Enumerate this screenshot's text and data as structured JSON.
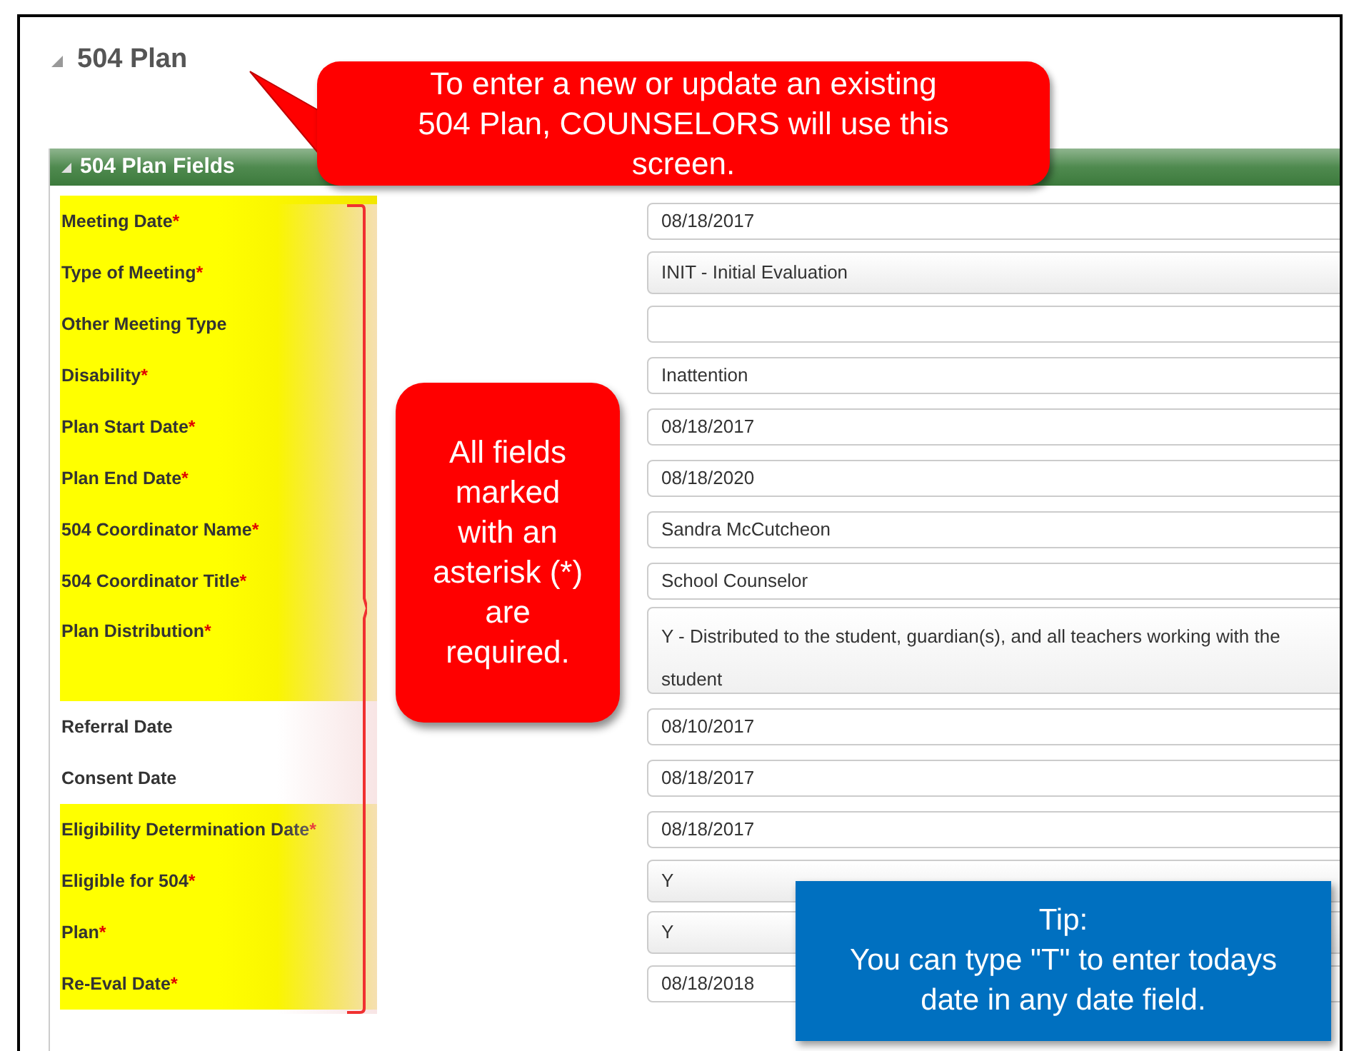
{
  "page_title": "504 Plan",
  "section": {
    "title": "504 Plan Fields",
    "expanded": true
  },
  "fields": [
    {
      "label": "Meeting Date",
      "asterisk": "*",
      "kind": "input",
      "value": "08/18/2017",
      "highlighted": true
    },
    {
      "label": "Type of Meeting",
      "asterisk": "*",
      "kind": "select",
      "value": "INIT - Initial Evaluation",
      "highlighted": true
    },
    {
      "label": "Other Meeting Type",
      "kind": "input",
      "highlighted": true
    },
    {
      "label": "Disability",
      "asterisk": "*",
      "kind": "input",
      "value": "Inattention",
      "highlighted": true
    },
    {
      "label": "Plan Start Date",
      "asterisk": "*",
      "kind": "input",
      "value": "08/18/2017",
      "highlighted": true
    },
    {
      "label": "Plan End Date",
      "asterisk": "*",
      "kind": "input",
      "value": "08/18/2020",
      "highlighted": true
    },
    {
      "label": "504 Coordinator Name",
      "asterisk": "*",
      "kind": "input",
      "value": "Sandra McCutcheon",
      "highlighted": true
    },
    {
      "label": "504 Coordinator Title",
      "asterisk": "*",
      "kind": "input",
      "value": "School Counselor",
      "highlighted": true
    },
    {
      "label": "Plan Distribution",
      "asterisk": "*",
      "kind": "textarea",
      "value": "Y - Distributed to the student, guardian(s), and all teachers working with the student",
      "highlighted": true
    },
    {
      "label": "Referral Date",
      "kind": "input",
      "value": "08/10/2017",
      "highlighted": false
    },
    {
      "label": "Consent Date",
      "kind": "input",
      "value": "08/18/2017",
      "highlighted": false
    },
    {
      "label": "Eligibility Determination Date",
      "asterisk": "*",
      "kind": "input",
      "value": "08/18/2017",
      "highlighted": true
    },
    {
      "label": "Eligible for 504",
      "asterisk": "*",
      "kind": "select",
      "value": "Y",
      "highlighted": true
    },
    {
      "label": "Plan",
      "asterisk": "*",
      "kind": "select",
      "value": "Y",
      "highlighted": true
    },
    {
      "label": "Re-Eval Date",
      "asterisk": "*",
      "kind": "input",
      "value": "08/18/2018",
      "highlighted": true
    }
  ],
  "callouts": [
    {
      "kind": "speech",
      "text": "To enter a new or update an existing 504 Plan, COUNSELORS will use this screen."
    },
    {
      "kind": "note",
      "text": "All fields marked with an asterisk (*) are required."
    },
    {
      "kind": "tip",
      "text": "Tip:\nYou can type \"T\" to enter todays date in any date field."
    }
  ]
}
